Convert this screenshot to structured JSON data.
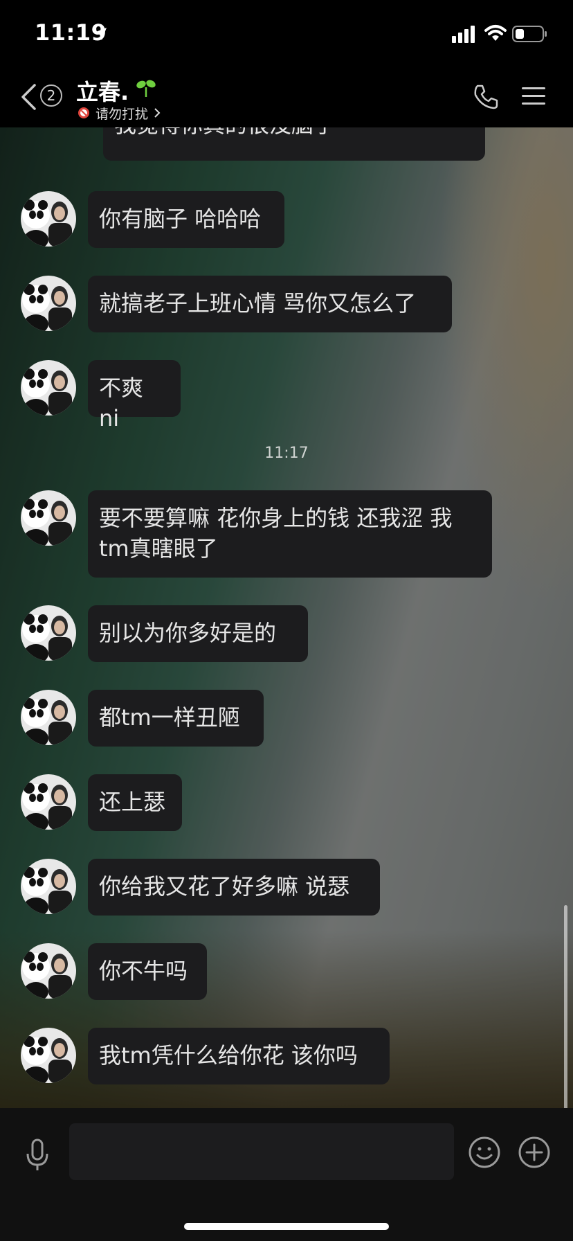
{
  "status_bar": {
    "time": "11:19"
  },
  "nav": {
    "unread_count": "2",
    "contact_name": "立春.",
    "status_text": "请勿打扰"
  },
  "chat": {
    "partial_top_message": "我觉得你真的很没脑子",
    "messages_before_divider": [
      "你有脑子 哈哈哈",
      "就搞老子上班心情 骂你又怎么了",
      "不爽 ni"
    ],
    "time_divider": "11:17",
    "messages_after_divider": [
      "要不要算嘛 花你身上的钱 还我涩 我tm真瞎眼了",
      "别以为你多好是的",
      "都tm一样丑陋",
      "还上瑟",
      "你给我又花了好多嘛 说瑟",
      "你不牛吗",
      "我tm凭什么给你花 该你吗"
    ]
  },
  "input_bar": {
    "value": "",
    "placeholder": ""
  },
  "colors": {
    "bubble": "#1c1c1e",
    "bar_bg": "#000000",
    "dnd_red": "#e0453d",
    "sprout_green": "#6fcf3f"
  },
  "icons": [
    "location-arrow-icon",
    "signal-icon",
    "wifi-icon",
    "battery-icon",
    "back-chevron-icon",
    "sprout-icon",
    "do-not-disturb-icon",
    "phone-icon",
    "menu-icon",
    "microphone-icon",
    "emoji-icon",
    "plus-icon"
  ]
}
